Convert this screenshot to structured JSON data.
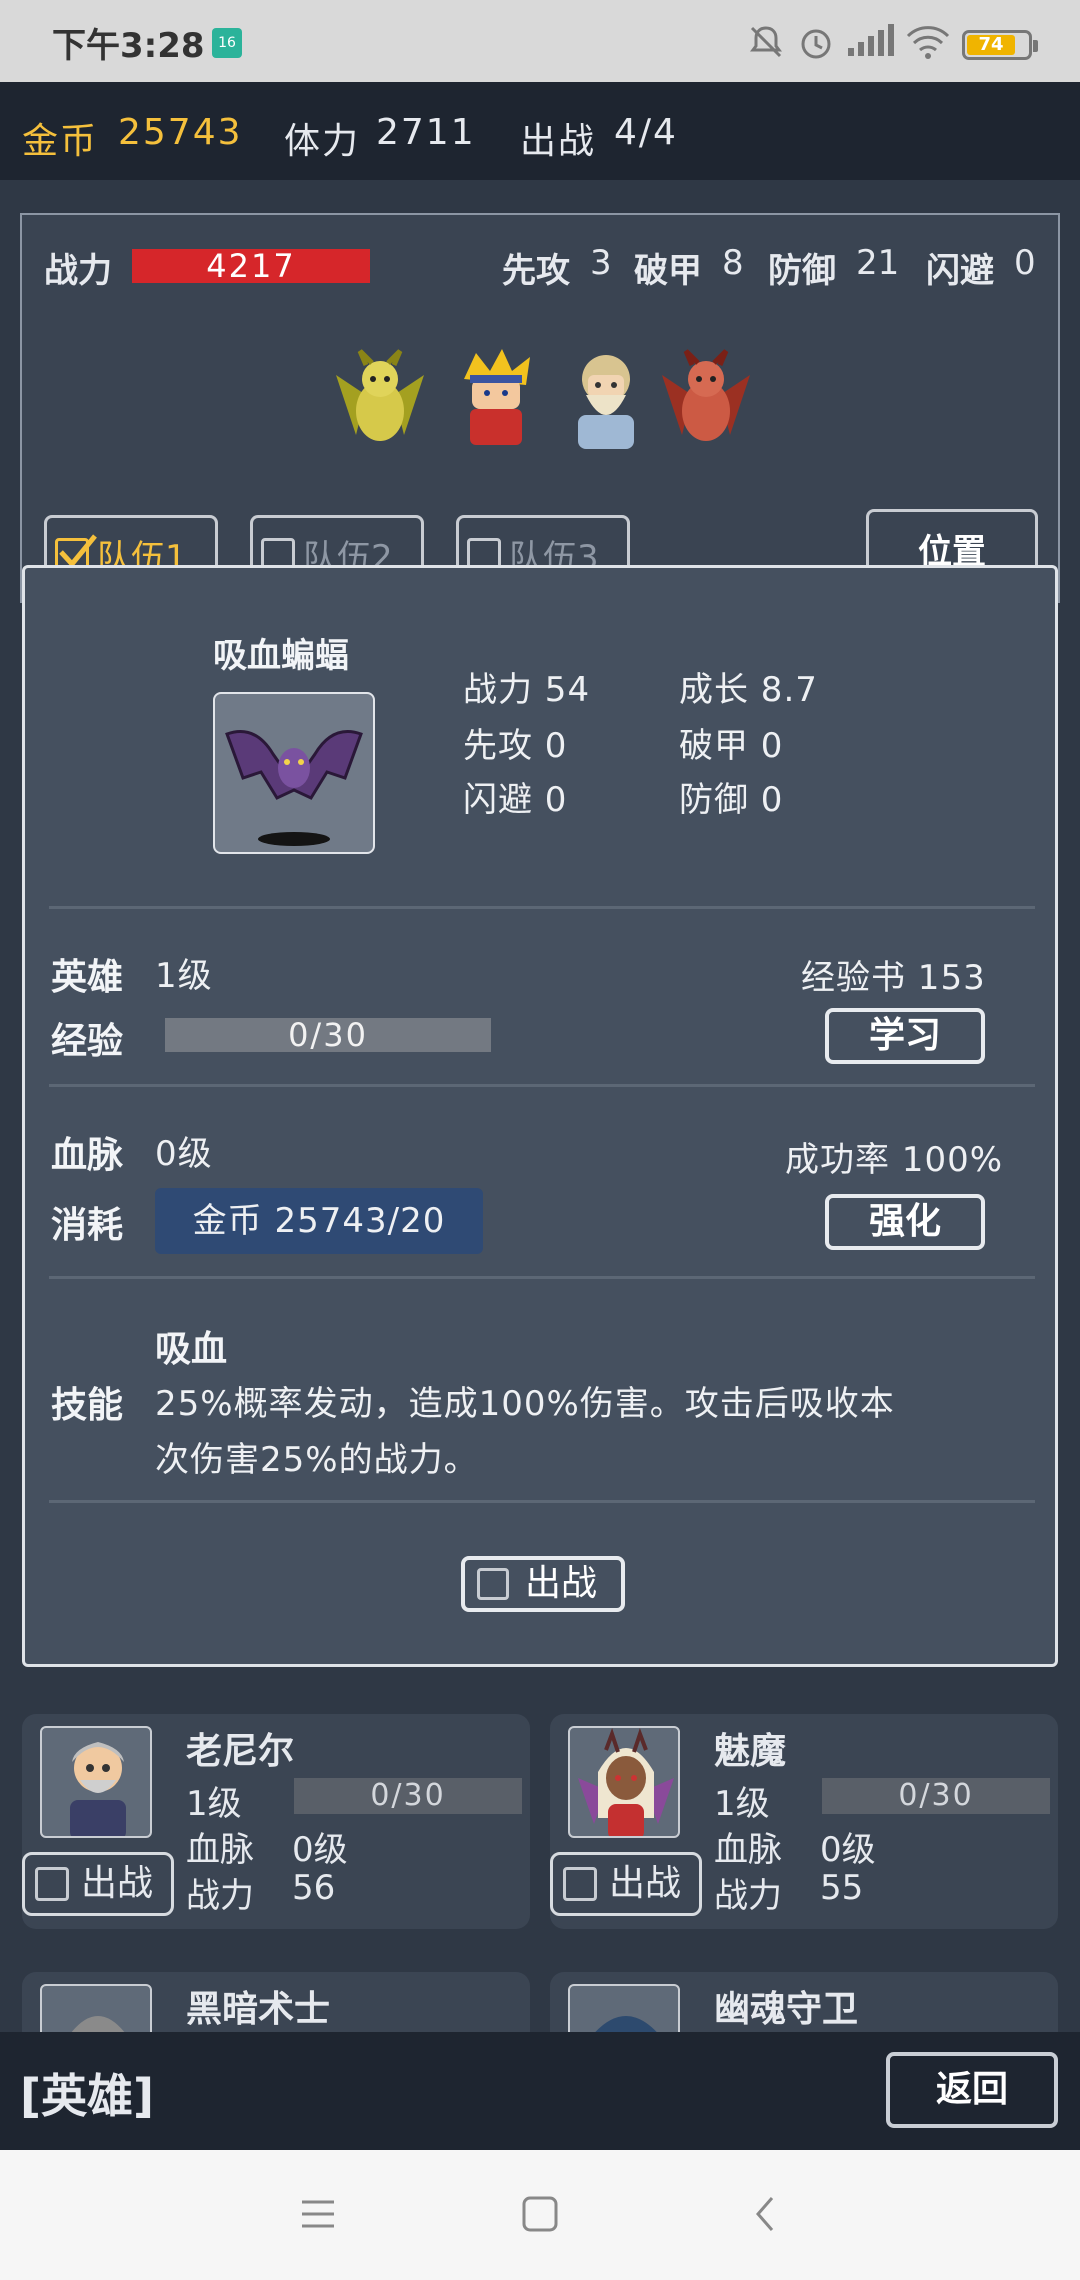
{
  "status_bar": {
    "time": "下午3:28",
    "notification_badge": "16",
    "battery": "74",
    "icons": [
      "bell-off-icon",
      "alarm-icon",
      "signal-icon",
      "wifi-icon",
      "battery-icon"
    ]
  },
  "resources": {
    "gold_label": "金币",
    "gold_value": "25743",
    "stamina_label": "体力",
    "stamina_value": "2711",
    "deploy_label": "出战",
    "deploy_value": "4/4"
  },
  "team": {
    "power_label": "战力",
    "power_value": "4217",
    "stats": [
      {
        "label": "先攻",
        "value": "3"
      },
      {
        "label": "破甲",
        "value": "8"
      },
      {
        "label": "防御",
        "value": "21"
      },
      {
        "label": "闪避",
        "value": "0"
      }
    ],
    "tabs": [
      {
        "label": "队伍1",
        "checked": true
      },
      {
        "label": "队伍2",
        "checked": false
      },
      {
        "label": "队伍3",
        "checked": false
      }
    ],
    "position_button": "位置"
  },
  "detail": {
    "name": "吸血蝙蝠",
    "stats": {
      "power": "战力 54",
      "growth": "成长 8.7",
      "initiative": "先攻 0",
      "armor_break": "破甲 0",
      "dodge": "闪避 0",
      "defense": "防御 0"
    },
    "hero_label": "英雄",
    "hero_level": "1级",
    "exp_book": "经验书 153",
    "exp_label": "经验",
    "exp_value": "0/30",
    "exp_fraction": 0,
    "learn_button": "学习",
    "bloodline_label": "血脉",
    "bloodline_level": "0级",
    "success_rate": "成功率 100%",
    "cost_label": "消耗",
    "cost_value": "金币 25743/20",
    "enhance_button": "强化",
    "skill_label": "技能",
    "skill_name": "吸血",
    "skill_desc_1": "25%概率发动，造成100%伤害。攻击后吸收本",
    "skill_desc_2": "次伤害25%的战力。",
    "deploy_checkbox": "出战"
  },
  "hero_list": [
    {
      "name": "老尼尔",
      "level": "1级",
      "exp": "0/30",
      "bloodline_label": "血脉",
      "bloodline": "0级",
      "power_label": "战力",
      "power": "56",
      "deploy": "出战"
    },
    {
      "name": "魅魔",
      "level": "1级",
      "exp": "0/30",
      "bloodline_label": "血脉",
      "bloodline": "0级",
      "power_label": "战力",
      "power": "55",
      "deploy": "出战"
    },
    {
      "name": "黑暗术士"
    },
    {
      "name": "幽魂守卫"
    }
  ],
  "footer": {
    "title": "[英雄]",
    "back_button": "返回"
  },
  "nav_icons": [
    "menu-icon",
    "home-icon",
    "back-icon"
  ]
}
